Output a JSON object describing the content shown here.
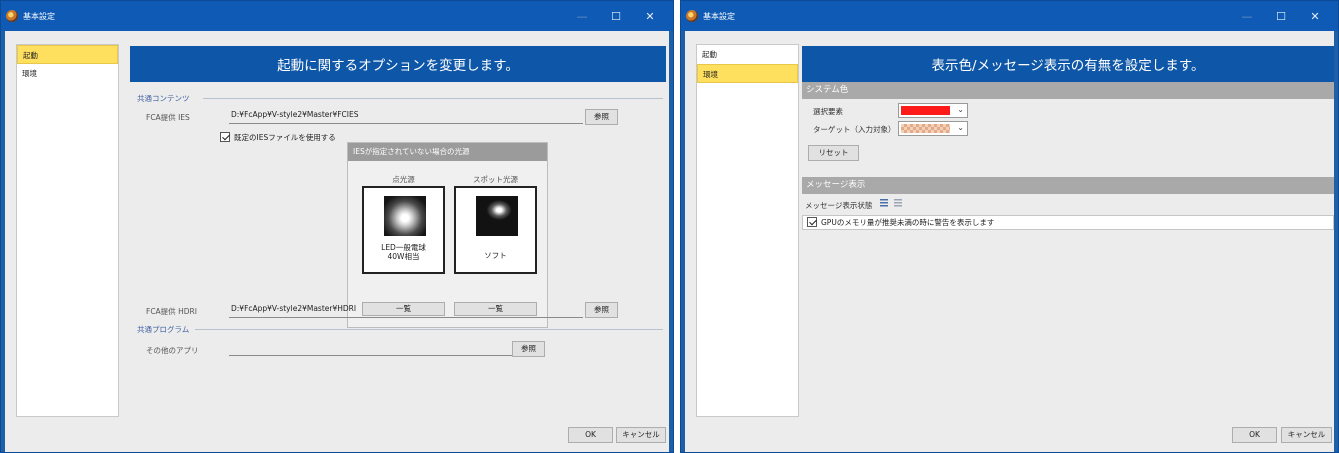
{
  "left_window": {
    "title": "基本設定",
    "controls": {
      "minimize": "—",
      "maximize": "☐",
      "close": "✕"
    },
    "nav": [
      {
        "label": "起動",
        "selected": true
      },
      {
        "label": "環境",
        "selected": false
      }
    ],
    "header": "起動に関するオプションを変更します。",
    "group_common_contents": "共通コンテンツ",
    "ies": {
      "label": "FCA提供 IES",
      "path": "D:¥FcApp¥V-style2¥Master¥FCIES",
      "browse": "参照",
      "checkbox_label": "既定のIESファイルを使用する",
      "checked": true
    },
    "light_panel": {
      "title": "IESが指定されていない場合の光源",
      "point": {
        "label": "点光源",
        "caption_line1": "LED一般電球",
        "caption_line2": "40W相当",
        "button": "一覧"
      },
      "spot": {
        "label": "スポット光源",
        "caption": "ソフト",
        "button": "一覧"
      }
    },
    "hdri": {
      "label": "FCA提供 HDRI",
      "path": "D:¥FcApp¥V-style2¥Master¥HDRI",
      "browse": "参照"
    },
    "group_common_programs": "共通プログラム",
    "other_app": {
      "label": "その他のアプリ",
      "path": "",
      "browse": "参照"
    },
    "ok": "OK",
    "cancel": "キャンセル"
  },
  "right_window": {
    "title": "基本設定",
    "controls": {
      "minimize": "—",
      "maximize": "☐",
      "close": "✕"
    },
    "nav": [
      {
        "label": "起動",
        "selected": false
      },
      {
        "label": "環境",
        "selected": true
      }
    ],
    "header": "表示色/メッセージ表示の有無を設定します。",
    "system_color": {
      "section": "システム色",
      "selection_label": "選択要素",
      "selection_color": "#ff1a1a",
      "target_label": "ターゲット（入力対象）",
      "reset": "リセット"
    },
    "message": {
      "section": "メッセージ表示",
      "state_label": "メッセージ表示状態",
      "gpu_warning": "GPUのメモリ量が推奨未満の時に警告を表示します",
      "gpu_checked": true
    },
    "ok": "OK",
    "cancel": "キャンセル"
  }
}
